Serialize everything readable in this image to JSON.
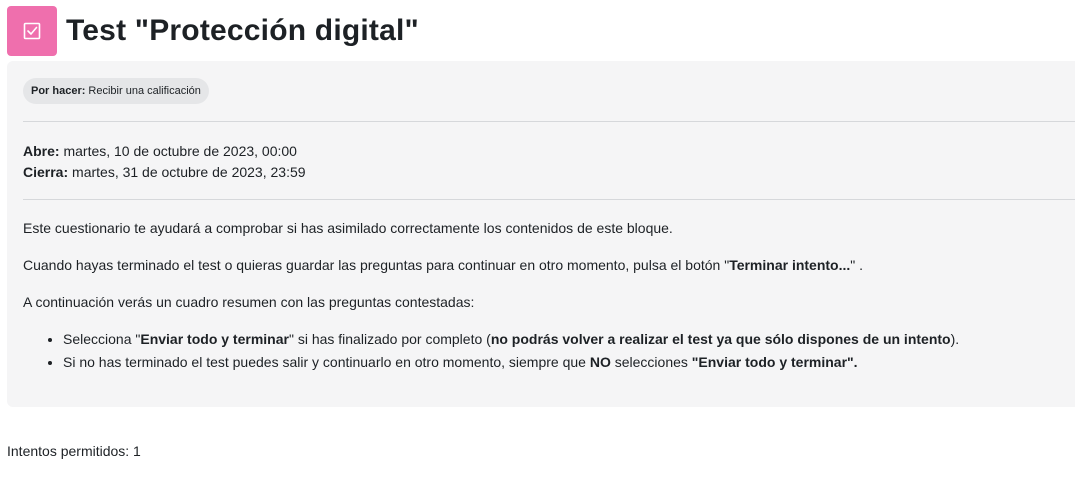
{
  "header": {
    "icon": "checkbox-icon",
    "icon_color": "#ef6fad",
    "title": "Test \"Protección digital\""
  },
  "completion": {
    "label": "Por hacer:",
    "value": "Recibir una calificación"
  },
  "dates": {
    "open_label": "Abre:",
    "open_value": "martes, 10 de octubre de 2023, 00:00",
    "close_label": "Cierra:",
    "close_value": "martes, 31 de octubre de 2023, 23:59"
  },
  "intro": {
    "p1": "Este cuestionario te ayudará a comprobar si has asimilado correctamente los contenidos de este bloque.",
    "p2_before": "Cuando hayas terminado el test o quieras guardar las preguntas para continuar en otro momento, pulsa el botón \"",
    "p2_bold": "Terminar intento...",
    "p2_after": "\" .",
    "p3": "A continuación verás un cuadro resumen con las preguntas contestadas:",
    "bullet1_a": "Selecciona \"",
    "bullet1_b": "Enviar todo y terminar",
    "bullet1_c": "\" si has finalizado por completo (",
    "bullet1_d": "no podrás volver a realizar el test ya que sólo dispones de un intento",
    "bullet1_e": ").",
    "bullet2_a": "Si no has terminado el test puedes salir y continuarlo en otro momento, siempre que ",
    "bullet2_b": "NO",
    "bullet2_c": " selecciones ",
    "bullet2_d": "\"Enviar todo y terminar\"."
  },
  "attempts": {
    "text": "Intentos permitidos: 1"
  }
}
